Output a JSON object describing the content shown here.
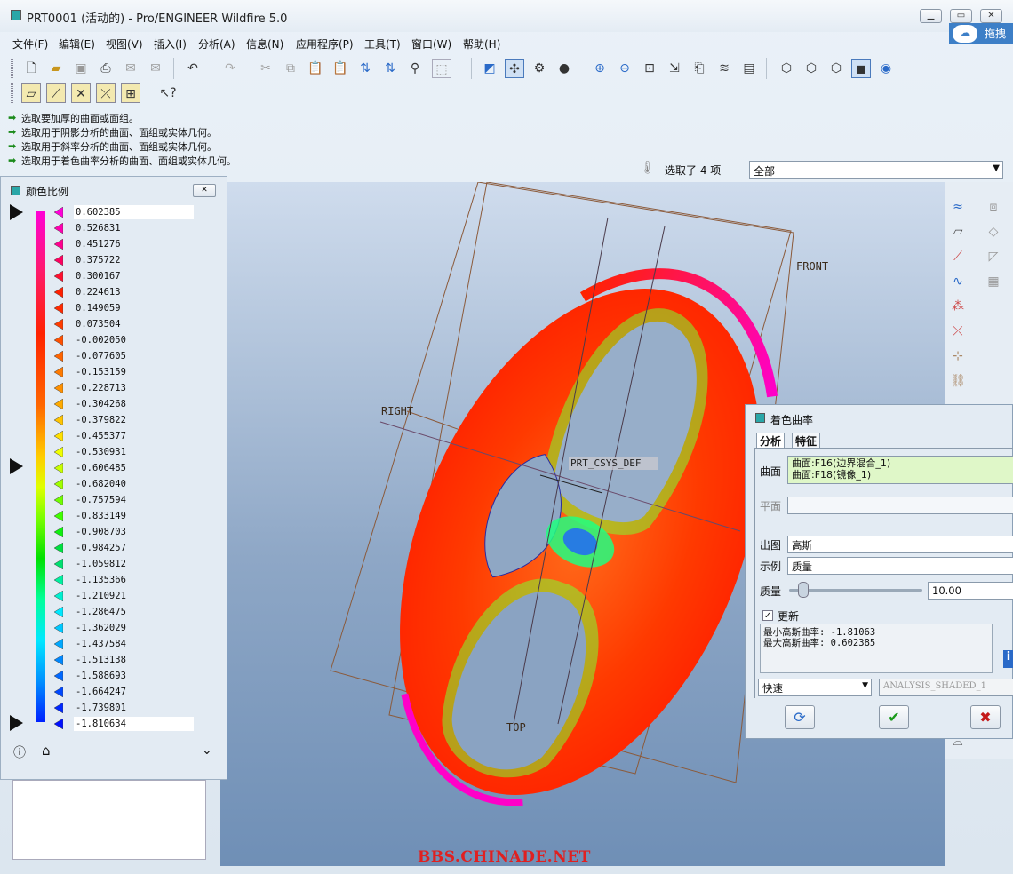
{
  "window": {
    "title": "PRT0001 (活动的) - Pro/ENGINEER Wildfire 5.0",
    "cloud_label": "拖拽"
  },
  "menu": [
    "文件(F)",
    "编辑(E)",
    "视图(V)",
    "插入(I)",
    "分析(A)",
    "信息(N)",
    "应用程序(P)",
    "工具(T)",
    "窗口(W)",
    "帮助(H)"
  ],
  "messages": [
    "选取要加厚的曲面或面组。",
    "选取用于阴影分析的曲面、面组或实体几何。",
    "选取用于斜率分析的曲面、面组或实体几何。",
    "选取用于着色曲率分析的曲面、面组或实体几何。"
  ],
  "selection": {
    "label": "选取了 4 项",
    "filter": "全部"
  },
  "scale_panel": {
    "title": "颜色比例",
    "values": [
      "0.602385",
      "0.526831",
      "0.451276",
      "0.375722",
      "0.300167",
      "0.224613",
      "0.149059",
      "0.073504",
      "-0.002050",
      "-0.077605",
      "-0.153159",
      "-0.228713",
      "-0.304268",
      "-0.379822",
      "-0.455377",
      "-0.530931",
      "-0.606485",
      "-0.682040",
      "-0.757594",
      "-0.833149",
      "-0.908703",
      "-0.984257",
      "-1.059812",
      "-1.135366",
      "-1.210921",
      "-1.286475",
      "-1.362029",
      "-1.437584",
      "-1.513138",
      "-1.588693",
      "-1.664247",
      "-1.739801",
      "-1.810634"
    ],
    "tick_colors": [
      "#ff00d8",
      "#ff00b0",
      "#ff0090",
      "#ff0060",
      "#ff1030",
      "#ff2000",
      "#ff2a00",
      "#ff3c00",
      "#ff5000",
      "#ff6400",
      "#ff7a00",
      "#ff9000",
      "#ffaa00",
      "#ffc400",
      "#ffe000",
      "#f0ff00",
      "#c8ff00",
      "#a0ff00",
      "#70ff00",
      "#40ff00",
      "#10f010",
      "#00e040",
      "#00e070",
      "#00f0a0",
      "#00f0d0",
      "#00e8ff",
      "#00c8ff",
      "#00a8ff",
      "#0088ff",
      "#0068ff",
      "#0048ff",
      "#0028ff",
      "#0010ff"
    ]
  },
  "viewport": {
    "labels": {
      "front": "FRONT",
      "right": "RIGHT",
      "top": "TOP",
      "csys": "PRT_CSYS_DEF"
    },
    "watermark": "BBS.CHINADE.NET"
  },
  "dialog": {
    "title": "着色曲率",
    "tabs": [
      "分析",
      "特征"
    ],
    "surface_label": "曲面",
    "surfaces": [
      "曲面:F16(边界混合_1)",
      "曲面:F18(镜像_1)"
    ],
    "plane_label": "平面",
    "output_label": "出图",
    "output_value": "高斯",
    "display_label": "示例",
    "display_value": "质量",
    "quality_label": "质量",
    "quality_value": "10.00",
    "update_label": "更新",
    "min_text": "最小高斯曲率: -1.81063",
    "max_text": "最大高斯曲率: 0.602385",
    "mode": "快速",
    "analysis_name": "ANALYSIS_SHADED_1"
  }
}
